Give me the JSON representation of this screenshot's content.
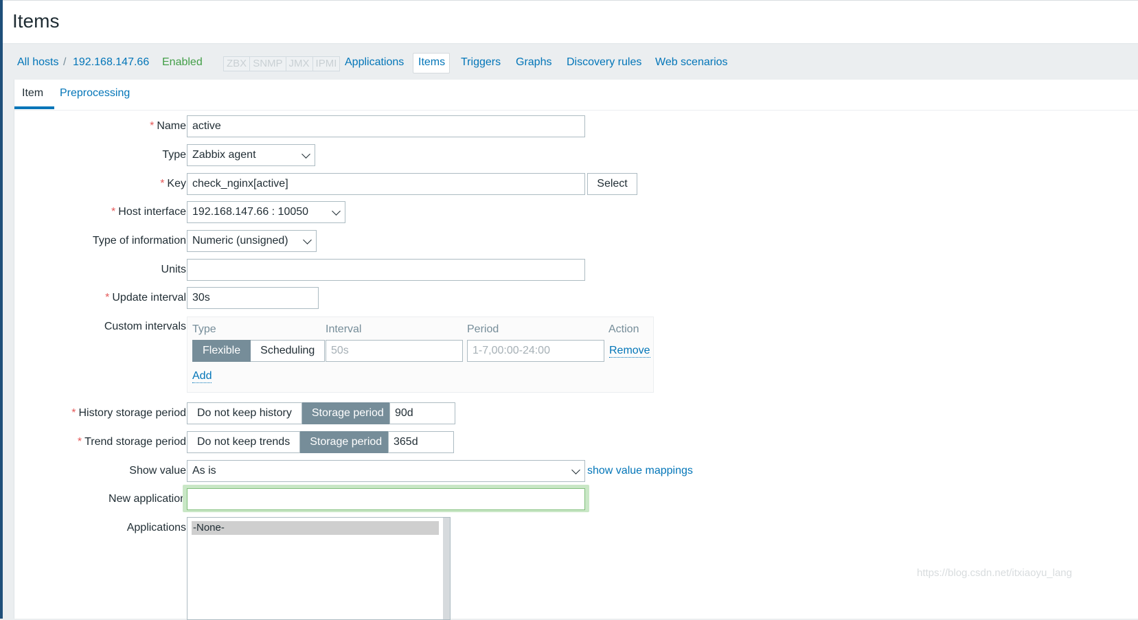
{
  "page": {
    "title": "Items"
  },
  "host_nav": {
    "all_hosts": "All hosts",
    "separator": "/",
    "host": "192.168.147.66",
    "status": "Enabled",
    "availability": [
      "ZBX",
      "SNMP",
      "JMX",
      "IPMI"
    ],
    "links": {
      "applications": "Applications",
      "items": "Items",
      "triggers": "Triggers",
      "graphs": "Graphs",
      "discovery_rules": "Discovery rules",
      "web_scenarios": "Web scenarios"
    },
    "selected": "Items"
  },
  "tabs": {
    "item": "Item",
    "preprocessing": "Preprocessing",
    "active": "Item"
  },
  "form": {
    "required_mark": "*",
    "name": {
      "label": "Name",
      "value": "active"
    },
    "type": {
      "label": "Type",
      "value": "Zabbix agent"
    },
    "key": {
      "label": "Key",
      "value": "check_nginx[active]",
      "select_button": "Select"
    },
    "host_interface": {
      "label": "Host interface",
      "value": "192.168.147.66 : 10050"
    },
    "type_of_information": {
      "label": "Type of information",
      "value": "Numeric (unsigned)"
    },
    "units": {
      "label": "Units",
      "value": ""
    },
    "update_interval": {
      "label": "Update interval",
      "value": "30s"
    },
    "custom_intervals": {
      "label": "Custom intervals",
      "headers": {
        "type": "Type",
        "interval": "Interval",
        "period": "Period",
        "action": "Action"
      },
      "row": {
        "type_options": [
          "Flexible",
          "Scheduling"
        ],
        "type_selected": "Flexible",
        "interval_placeholder": "50s",
        "period_placeholder": "1-7,00:00-24:00",
        "remove": "Remove"
      },
      "add": "Add"
    },
    "history_storage_period": {
      "label": "History storage period",
      "options": [
        "Do not keep history",
        "Storage period"
      ],
      "selected": "Storage period",
      "value": "90d"
    },
    "trend_storage_period": {
      "label": "Trend storage period",
      "options": [
        "Do not keep trends",
        "Storage period"
      ],
      "selected": "Storage period",
      "value": "365d"
    },
    "show_value": {
      "label": "Show value",
      "value": "As is",
      "mappings_link": "show value mappings"
    },
    "new_application": {
      "label": "New application",
      "value": ""
    },
    "applications": {
      "label": "Applications",
      "options": [
        "-None-"
      ],
      "selected": "-None-"
    }
  },
  "watermark": "https://blog.csdn.net/itxiaoyu_lang",
  "colors": {
    "link": "#0275b8",
    "enabled": "#429e47",
    "required": "#e45959",
    "selected_segment": "#768d99"
  }
}
